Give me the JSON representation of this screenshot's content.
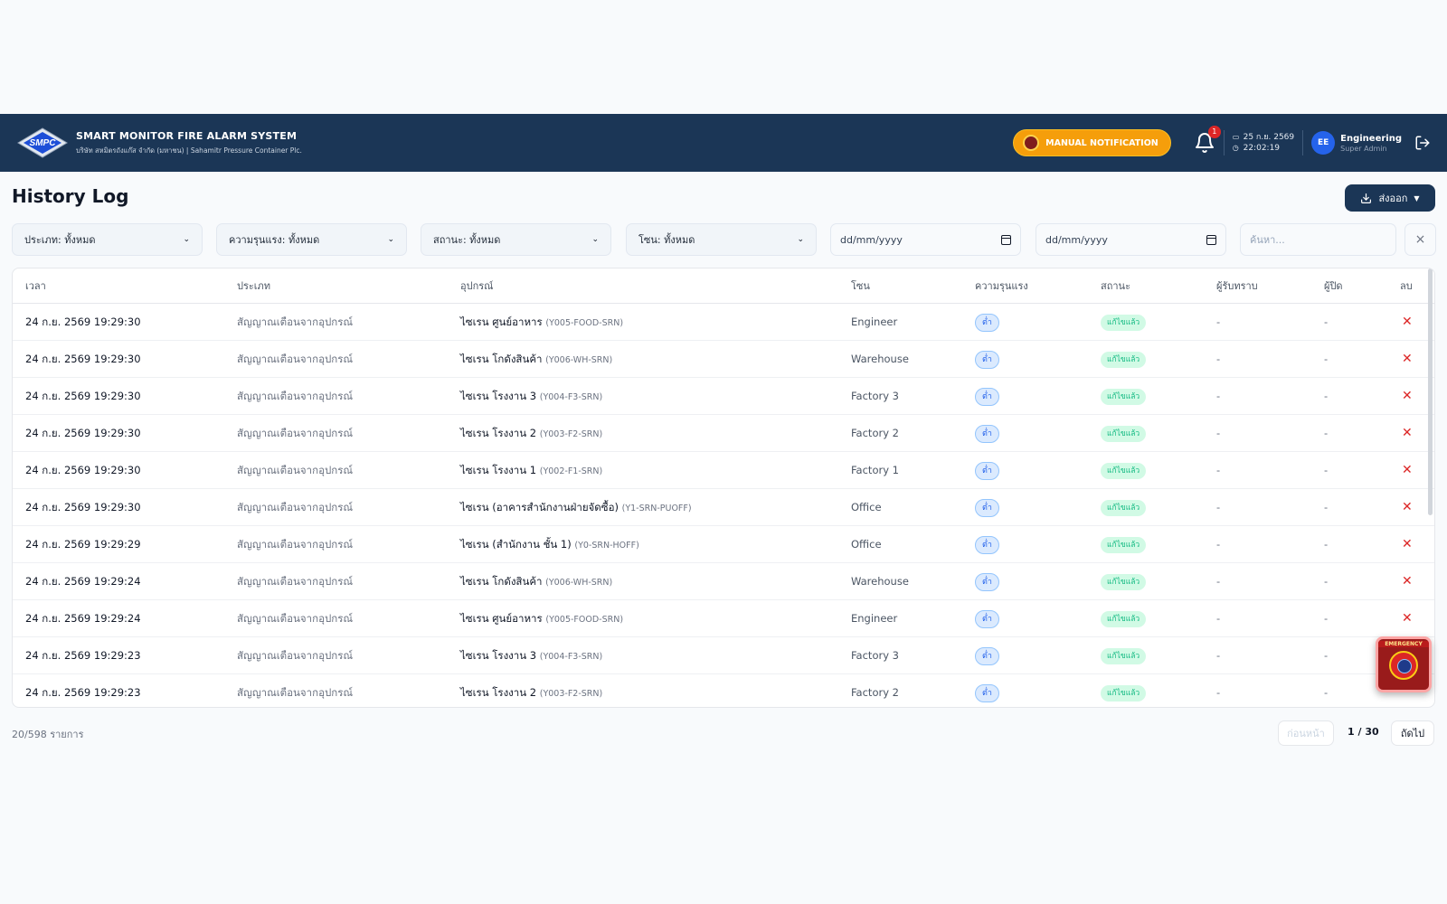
{
  "app": {
    "title": "SMART MONITOR FIRE ALARM SYSTEM",
    "subtitle": "บริษัท สหมิตรถังแก๊ส จำกัด (มหาชน) | Sahamitr Pressure Container Plc.",
    "logo_text": "SMPC"
  },
  "header": {
    "manual_button": "MANUAL NOTIFICATION",
    "notification_count": "1",
    "date": "25 ก.ย. 2569",
    "time": "22:02:19",
    "avatar_initials": "EE",
    "user_name": "Engineering",
    "user_role": "Super Admin"
  },
  "page": {
    "title": "History Log",
    "export_label": "ส่งออก"
  },
  "filters": {
    "type": "ประเภท: ทั้งหมด",
    "severity": "ความรุนแรง: ทั้งหมด",
    "status": "สถานะ: ทั้งหมด",
    "zone": "โซน: ทั้งหมด",
    "date_from": "dd/mm/yyyy",
    "date_to": "dd/mm/yyyy",
    "search_placeholder": "ค้นหา...",
    "clear": "×"
  },
  "table": {
    "columns": [
      "เวลา",
      "ประเภท",
      "อุปกรณ์",
      "โซน",
      "ความรุนแรง",
      "สถานะ",
      "ผู้รับทราบ",
      "ผู้ปิด",
      "ลบ"
    ],
    "rows": [
      {
        "time": "24 ก.ย. 2569 19:29:30",
        "type": "สัญญาณเตือนจากอุปกรณ์",
        "device": "ไซเรน ศูนย์อาหาร",
        "code": "(Y005-FOOD-SRN)",
        "zone": "Engineer",
        "severity": "ต่ำ",
        "status": "แก้ไขแล้ว",
        "ack": "-",
        "closer": "-",
        "del": "✕"
      },
      {
        "time": "24 ก.ย. 2569 19:29:30",
        "type": "สัญญาณเตือนจากอุปกรณ์",
        "device": "ไซเรน โกดังสินค้า",
        "code": "(Y006-WH-SRN)",
        "zone": "Warehouse",
        "severity": "ต่ำ",
        "status": "แก้ไขแล้ว",
        "ack": "-",
        "closer": "-",
        "del": "✕"
      },
      {
        "time": "24 ก.ย. 2569 19:29:30",
        "type": "สัญญาณเตือนจากอุปกรณ์",
        "device": "ไซเรน โรงงาน 3",
        "code": "(Y004-F3-SRN)",
        "zone": "Factory 3",
        "severity": "ต่ำ",
        "status": "แก้ไขแล้ว",
        "ack": "-",
        "closer": "-",
        "del": "✕"
      },
      {
        "time": "24 ก.ย. 2569 19:29:30",
        "type": "สัญญาณเตือนจากอุปกรณ์",
        "device": "ไซเรน โรงงาน 2",
        "code": "(Y003-F2-SRN)",
        "zone": "Factory 2",
        "severity": "ต่ำ",
        "status": "แก้ไขแล้ว",
        "ack": "-",
        "closer": "-",
        "del": "✕"
      },
      {
        "time": "24 ก.ย. 2569 19:29:30",
        "type": "สัญญาณเตือนจากอุปกรณ์",
        "device": "ไซเรน โรงงาน 1",
        "code": "(Y002-F1-SRN)",
        "zone": "Factory 1",
        "severity": "ต่ำ",
        "status": "แก้ไขแล้ว",
        "ack": "-",
        "closer": "-",
        "del": "✕"
      },
      {
        "time": "24 ก.ย. 2569 19:29:30",
        "type": "สัญญาณเตือนจากอุปกรณ์",
        "device": "ไซเรน (อาคารสำนักงานฝ่ายจัดซื้อ)",
        "code": "(Y1-SRN-PUOFF)",
        "zone": "Office",
        "severity": "ต่ำ",
        "status": "แก้ไขแล้ว",
        "ack": "-",
        "closer": "-",
        "del": "✕"
      },
      {
        "time": "24 ก.ย. 2569 19:29:29",
        "type": "สัญญาณเตือนจากอุปกรณ์",
        "device": "ไซเรน (สำนักงาน ชั้น 1)",
        "code": "(Y0-SRN-HOFF)",
        "zone": "Office",
        "severity": "ต่ำ",
        "status": "แก้ไขแล้ว",
        "ack": "-",
        "closer": "-",
        "del": "✕"
      },
      {
        "time": "24 ก.ย. 2569 19:29:24",
        "type": "สัญญาณเตือนจากอุปกรณ์",
        "device": "ไซเรน โกดังสินค้า",
        "code": "(Y006-WH-SRN)",
        "zone": "Warehouse",
        "severity": "ต่ำ",
        "status": "แก้ไขแล้ว",
        "ack": "-",
        "closer": "-",
        "del": "✕"
      },
      {
        "time": "24 ก.ย. 2569 19:29:24",
        "type": "สัญญาณเตือนจากอุปกรณ์",
        "device": "ไซเรน ศูนย์อาหาร",
        "code": "(Y005-FOOD-SRN)",
        "zone": "Engineer",
        "severity": "ต่ำ",
        "status": "แก้ไขแล้ว",
        "ack": "-",
        "closer": "-",
        "del": "✕"
      },
      {
        "time": "24 ก.ย. 2569 19:29:23",
        "type": "สัญญาณเตือนจากอุปกรณ์",
        "device": "ไซเรน โรงงาน 3",
        "code": "(Y004-F3-SRN)",
        "zone": "Factory 3",
        "severity": "ต่ำ",
        "status": "แก้ไขแล้ว",
        "ack": "-",
        "closer": "-",
        "del": ""
      },
      {
        "time": "24 ก.ย. 2569 19:29:23",
        "type": "สัญญาณเตือนจากอุปกรณ์",
        "device": "ไซเรน โรงงาน 2",
        "code": "(Y003-F2-SRN)",
        "zone": "Factory 2",
        "severity": "ต่ำ",
        "status": "แก้ไขแล้ว",
        "ack": "-",
        "closer": "-",
        "del": ""
      }
    ]
  },
  "footer": {
    "count": "20/598 รายการ",
    "prev": "ก่อนหน้า",
    "page": "1 / 30",
    "next": "ถัดไป"
  },
  "emergency": {
    "label": "EMERGENCY"
  },
  "colors": {
    "header_bg": "#1b3656",
    "accent_orange": "#f59e0b",
    "danger": "#dc2626",
    "success": "#10b981",
    "info": "#2563eb"
  }
}
